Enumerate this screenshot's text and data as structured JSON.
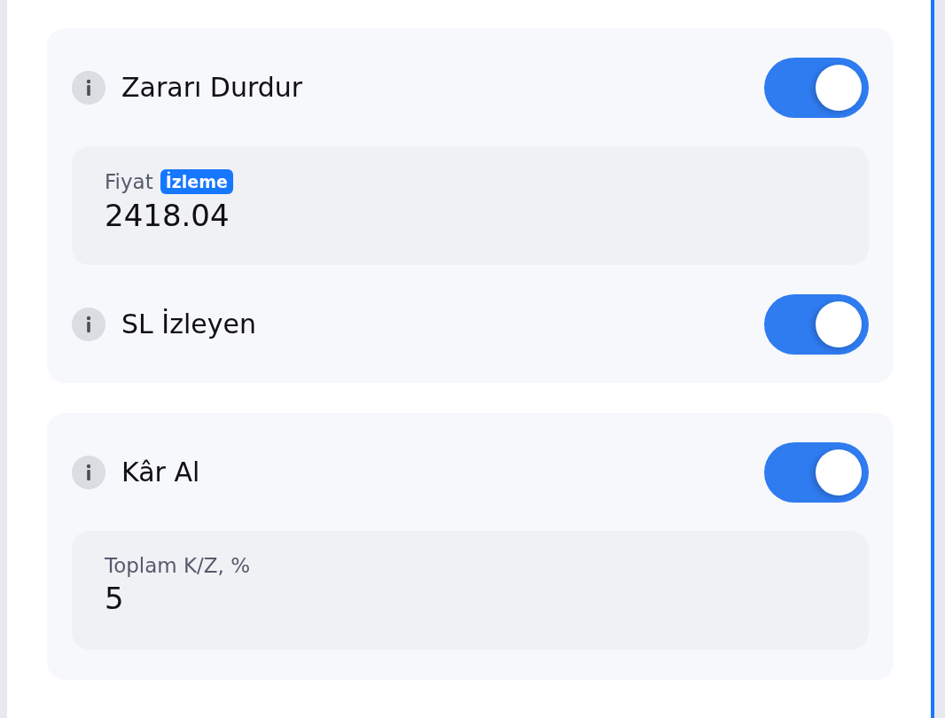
{
  "sections": [
    {
      "items": [
        {
          "kind": "toggle",
          "label": "Zararı Durdur",
          "on": true
        },
        {
          "kind": "field",
          "label": "Fiyat",
          "badge": "İzleme",
          "value": "2418.04"
        },
        {
          "kind": "toggle",
          "label": "SL İzleyen",
          "on": true
        }
      ]
    },
    {
      "items": [
        {
          "kind": "toggle",
          "label": "Kâr Al",
          "on": true
        },
        {
          "kind": "field",
          "label": "Toplam K/Z, %",
          "value": "5"
        }
      ]
    }
  ]
}
